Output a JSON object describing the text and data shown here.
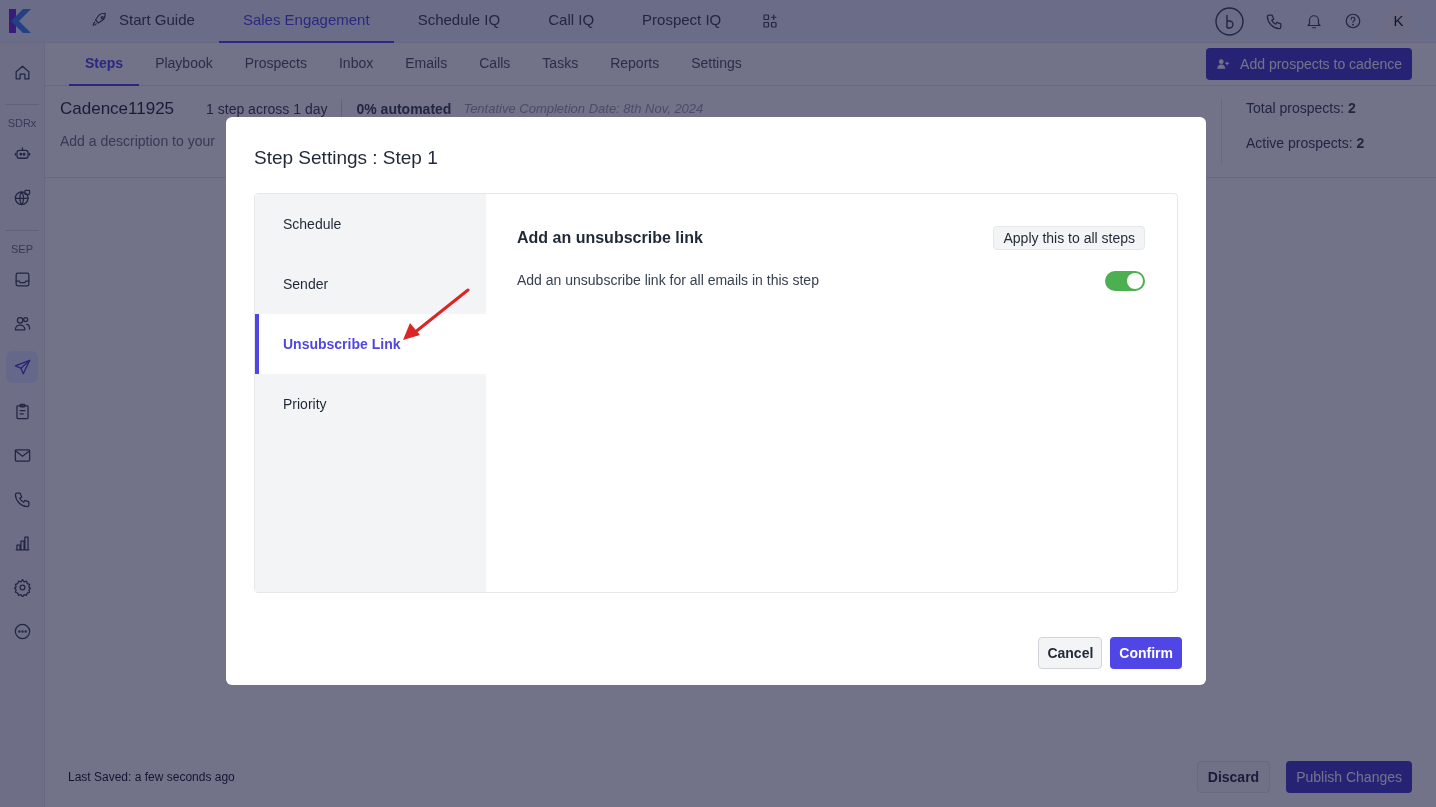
{
  "top_nav": {
    "tabs": [
      {
        "label": "Start Guide",
        "selected": false
      },
      {
        "label": "Sales Engagement",
        "selected": true
      },
      {
        "label": "Schedule IQ",
        "selected": false
      },
      {
        "label": "Call IQ",
        "selected": false
      },
      {
        "label": "Prospect IQ",
        "selected": false
      }
    ],
    "avatar": "K"
  },
  "sidebar": {
    "items": [
      {
        "kind": "icon",
        "selected": false
      },
      {
        "kind": "label",
        "label": "SDRx"
      },
      {
        "kind": "icon",
        "selected": false
      },
      {
        "kind": "icon",
        "selected": false
      },
      {
        "kind": "label",
        "label": "SEP"
      },
      {
        "kind": "icon",
        "selected": false
      },
      {
        "kind": "icon",
        "selected": false
      },
      {
        "kind": "icon",
        "selected": true
      },
      {
        "kind": "icon",
        "selected": false
      },
      {
        "kind": "icon",
        "selected": false
      },
      {
        "kind": "icon",
        "selected": false
      },
      {
        "kind": "icon",
        "selected": false
      },
      {
        "kind": "icon",
        "selected": false
      },
      {
        "kind": "icon",
        "selected": false
      }
    ]
  },
  "sub_tabs": [
    {
      "label": "Steps",
      "selected": true
    },
    {
      "label": "Playbook",
      "selected": false
    },
    {
      "label": "Prospects",
      "selected": false
    },
    {
      "label": "Inbox",
      "selected": false
    },
    {
      "label": "Emails",
      "selected": false
    },
    {
      "label": "Calls",
      "selected": false
    },
    {
      "label": "Tasks",
      "selected": false
    },
    {
      "label": "Reports",
      "selected": false
    },
    {
      "label": "Settings",
      "selected": false
    }
  ],
  "add_button": "Add prospects to cadence",
  "cadence": {
    "name": "Cadence11925",
    "steps_info": "1 step across 1 day",
    "automation": "0% automated",
    "completion": "Tentative Completion Date: 8th Nov, 2024",
    "description": "Add a description to your",
    "stats": [
      "Total prospects: **2**",
      "Active prospects: **2**"
    ]
  },
  "footer": {
    "last_saved": "Last Saved: a few seconds ago",
    "buttons": [
      "Discard",
      "Publish Changes"
    ]
  },
  "modal": {
    "title": "Step Settings : Step 1",
    "nav": [
      {
        "label": "Schedule",
        "selected": false
      },
      {
        "label": "Sender",
        "selected": false
      },
      {
        "label": "Unsubscribe Link",
        "selected": true
      },
      {
        "label": "Priority",
        "selected": false
      }
    ],
    "section_title": "Add an unsubscribe link",
    "apply_button": "Apply this to all steps",
    "setting": {
      "label": "Add an unsubscribe link for all emails in this step",
      "on": true
    },
    "buttons": [
      "Cancel",
      "Confirm"
    ]
  }
}
